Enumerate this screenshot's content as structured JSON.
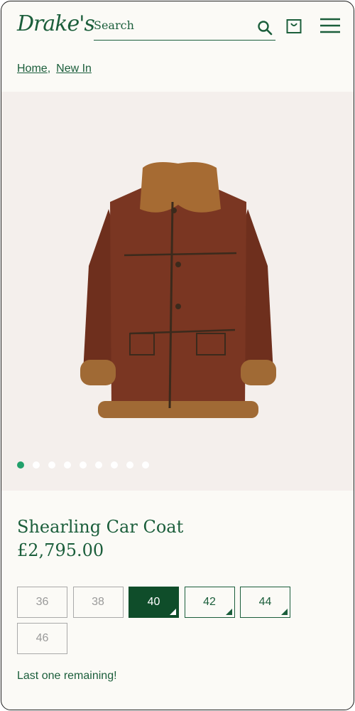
{
  "header": {
    "logo": "Drake's",
    "search_label": "Search"
  },
  "breadcrumb": {
    "items": [
      "Home",
      "New In"
    ],
    "separator": ","
  },
  "gallery": {
    "dot_count": 9,
    "active_index": 0,
    "icons": {
      "search": "search-icon",
      "bag": "shopping-bag-icon",
      "menu": "hamburger-menu-icon"
    }
  },
  "product": {
    "title": "Shearling Car Coat",
    "price": "£2,795.00",
    "sizes": [
      {
        "label": "36",
        "state": "unavailable"
      },
      {
        "label": "38",
        "state": "unavailable"
      },
      {
        "label": "40",
        "state": "selected"
      },
      {
        "label": "42",
        "state": "available"
      },
      {
        "label": "44",
        "state": "available"
      },
      {
        "label": "46",
        "state": "unavailable"
      }
    ],
    "stock_message": "Last one remaining!"
  },
  "colors": {
    "brand_green": "#1b5e3b",
    "selected_green": "#0f4d2a",
    "active_dot": "#22a06b",
    "page_bg": "#fbfaf6",
    "hero_bg": "#f4efec"
  }
}
